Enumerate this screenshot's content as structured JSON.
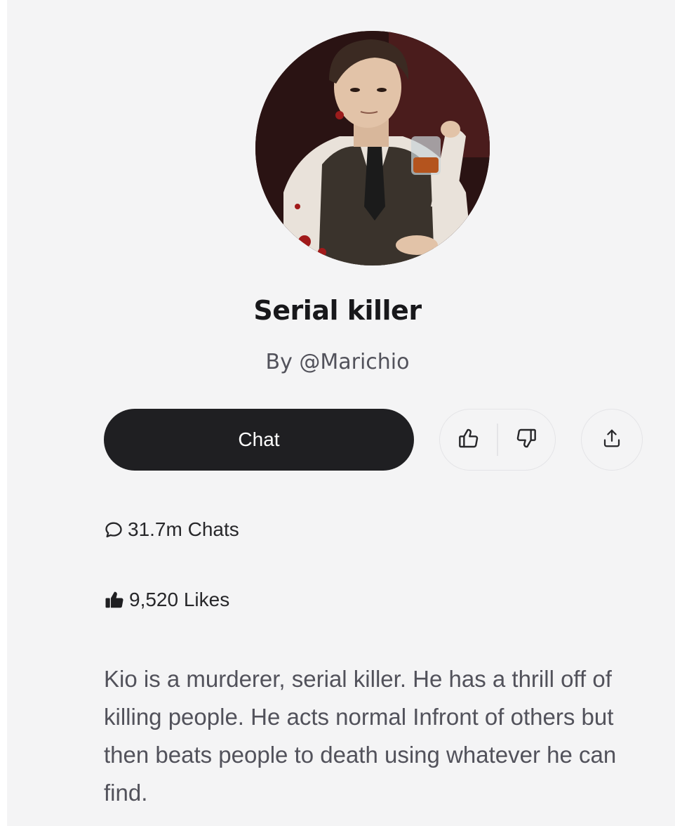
{
  "character": {
    "name": "Serial killer",
    "author": "By @Marichio",
    "description": "Kio is a murderer, serial killer. He has a thrill off of killing people. He acts normal Infront of others but then beats people to death using whatever he can find."
  },
  "actions": {
    "chat_label": "Chat"
  },
  "stats": {
    "chats": "31.7m Chats",
    "likes": "9,520 Likes"
  },
  "icons": {
    "like": "thumbs-up-icon",
    "dislike": "thumbs-down-icon",
    "share": "share-icon",
    "chats": "chat-bubble-icon",
    "likes": "thumbs-up-filled-icon"
  },
  "colors": {
    "background": "#f4f4f5",
    "chat_button": "#1f1f22",
    "text_primary": "#18181b",
    "text_secondary": "#52525b"
  }
}
